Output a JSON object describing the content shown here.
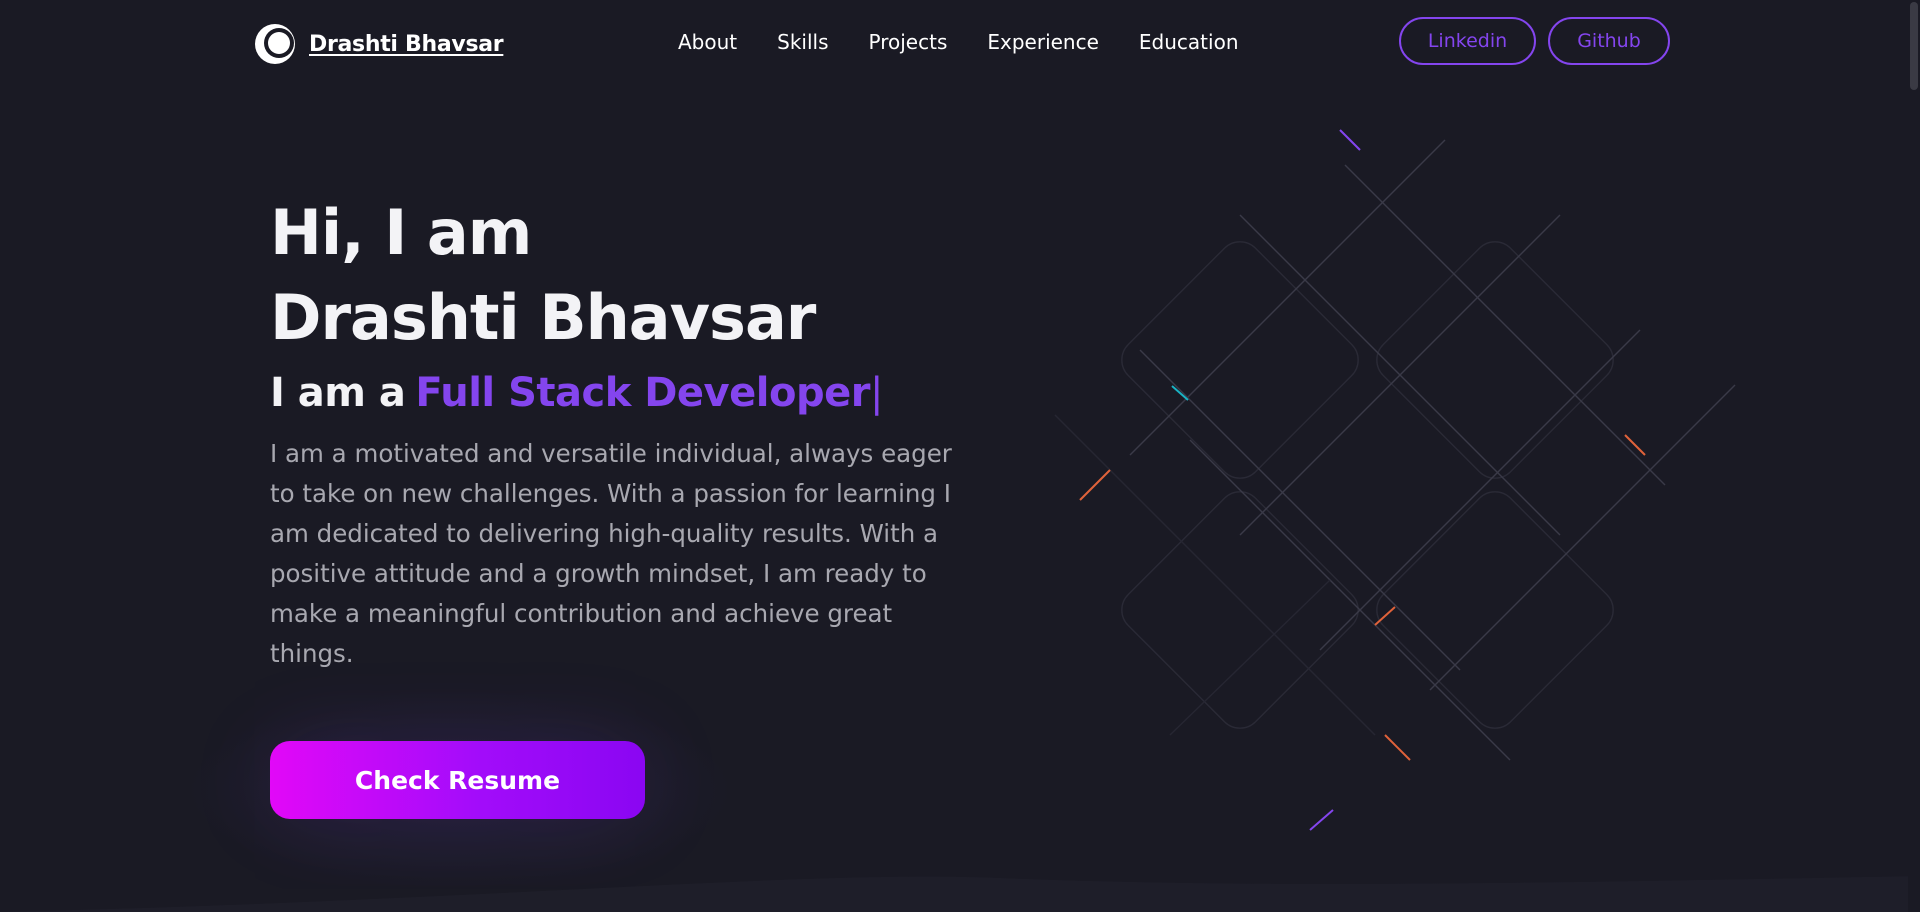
{
  "brand": {
    "name": "Drashti Bhavsar",
    "logo_icon": "circle-crescent-logo-icon"
  },
  "nav": {
    "items": [
      {
        "label": "About"
      },
      {
        "label": "Skills"
      },
      {
        "label": "Projects"
      },
      {
        "label": "Experience"
      },
      {
        "label": "Education"
      }
    ],
    "linkedin_label": "Linkedin",
    "github_label": "Github"
  },
  "hero": {
    "greeting": "Hi, I am",
    "name": "Drashti Bhavsar",
    "role_prefix": "I am a",
    "role_highlight": "Full Stack Developer",
    "caret": "|",
    "description": "I am a motivated and versatile individual, always eager to take on new challenges. With a passion for learning I am dedicated to delivering high-quality results. With a positive attitude and a growth mindset, I am ready to make a meaningful contribution and achieve great things.",
    "cta_label": "Check Resume"
  },
  "colors": {
    "background": "#1a1a24",
    "accent": "#8445ee",
    "cta_gradient_start": "#e208f8",
    "cta_gradient_end": "#8a06f2",
    "text_muted": "#a8a8b0"
  }
}
